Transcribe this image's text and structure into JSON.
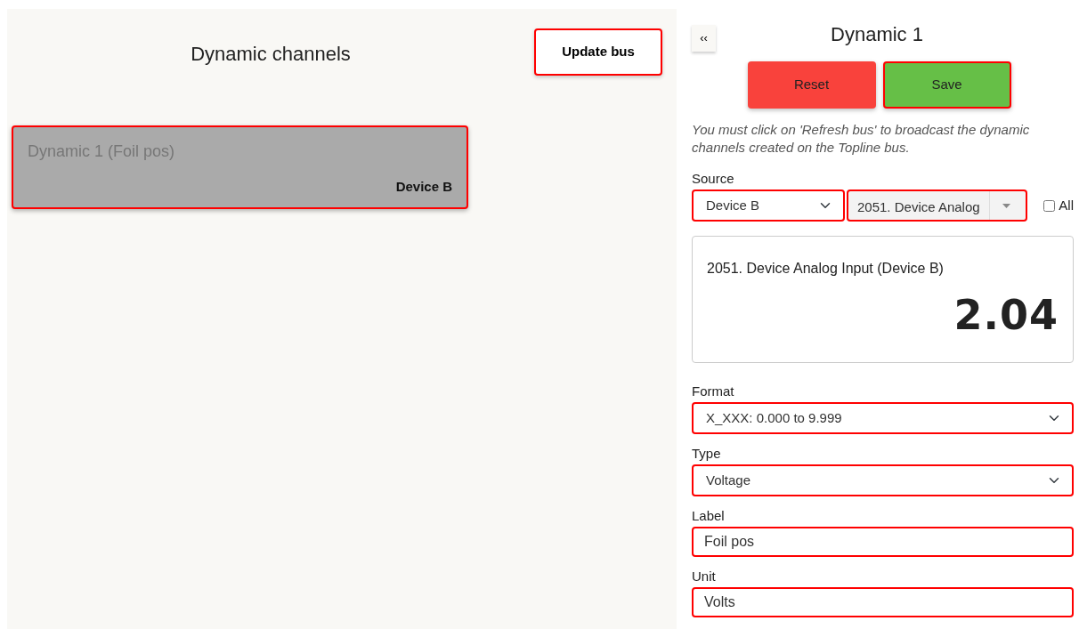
{
  "list_panel": {
    "title": "Dynamic channels",
    "update_button": "Update bus",
    "channels": [
      {
        "name": "Dynamic 1 (Foil pos)",
        "device": "Device B",
        "selected": true
      }
    ]
  },
  "editor": {
    "collapse_button": "‹‹",
    "title": "Dynamic 1",
    "reset_button": "Reset",
    "save_button": "Save",
    "note": "You must click on 'Refresh bus' to broadcast the dynamic channels created on the Topline bus.",
    "source": {
      "label": "Source",
      "device": "Device B",
      "channel": "2051. Device Analog",
      "all": {
        "label": "All",
        "checked": false
      }
    },
    "preview": {
      "title": "2051. Device Analog Input (Device B)",
      "value": "2.04"
    },
    "fields": [
      {
        "kind": "select",
        "label": "Format",
        "value": "X_XXX: 0.000 to 9.999"
      },
      {
        "kind": "select",
        "label": "Type",
        "value": "Voltage"
      },
      {
        "kind": "text",
        "label": "Label",
        "value": "Foil pos"
      },
      {
        "kind": "text",
        "label": "Unit",
        "value": "Volts"
      }
    ]
  }
}
